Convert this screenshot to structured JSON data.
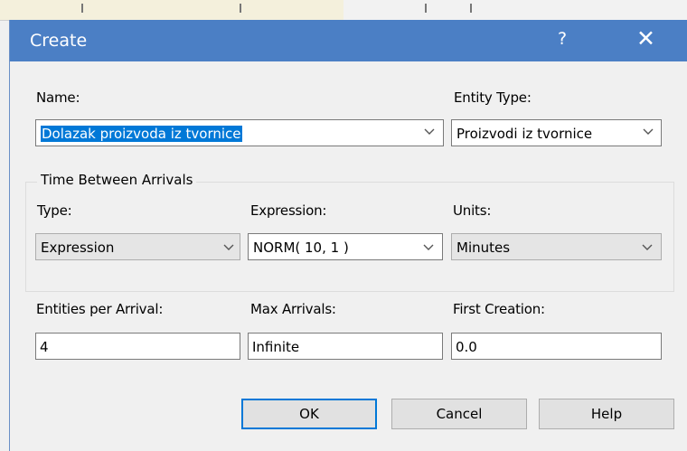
{
  "dialog": {
    "title": "Create",
    "help_glyph": "?",
    "close_glyph": "✕"
  },
  "name": {
    "label": "Name:",
    "value": "Dolazak proizvoda iz tvornice"
  },
  "entity_type": {
    "label": "Entity Type:",
    "value": "Proizvodi iz tvornice"
  },
  "time_between_arrivals": {
    "group_label": "Time Between Arrivals",
    "type_label": "Type:",
    "type_value": "Expression",
    "expression_label": "Expression:",
    "expression_value": "NORM( 10, 1 )",
    "units_label": "Units:",
    "units_value": "Minutes"
  },
  "entities_per_arrival": {
    "label": "Entities per Arrival:",
    "value": "4"
  },
  "max_arrivals": {
    "label": "Max Arrivals:",
    "value": "Infinite"
  },
  "first_creation": {
    "label": "First Creation:",
    "value": "0.0"
  },
  "buttons": {
    "ok": "OK",
    "cancel": "Cancel",
    "help": "Help"
  },
  "icons": [
    "help-icon",
    "close-icon",
    "chevron-down-icon"
  ],
  "colors": {
    "titlebar": "#4b7fc5",
    "selection": "#0078d7",
    "background": "#f0f0f0"
  }
}
